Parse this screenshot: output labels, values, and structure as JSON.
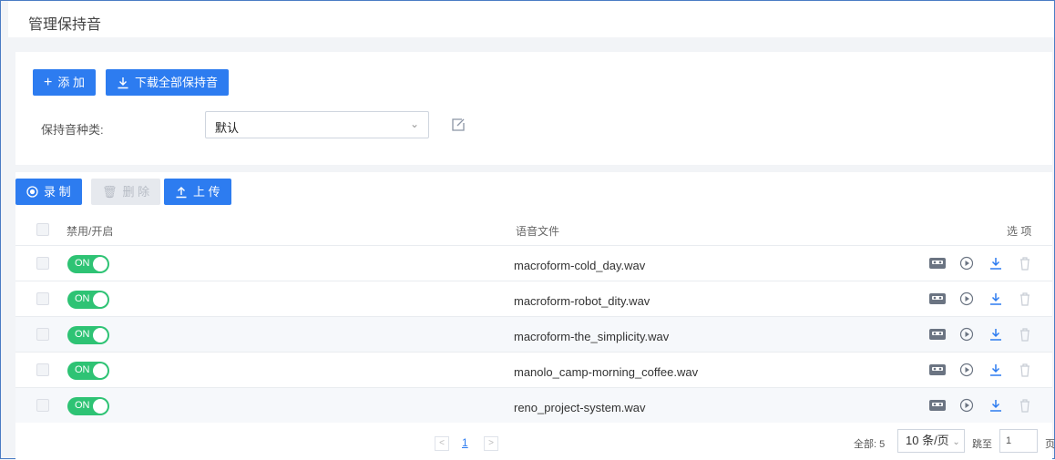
{
  "header": {
    "title": "管理保持音"
  },
  "toolbar": {
    "add_label": "添 加",
    "download_all_label": "下载全部保持音"
  },
  "filter": {
    "type_label": "保持音种类:",
    "type_value": "默认"
  },
  "actions": {
    "record_label": "录 制",
    "delete_label": "删 除",
    "upload_label": "上 传"
  },
  "table": {
    "headers": {
      "toggle": "禁用/开启",
      "file": "语音文件",
      "options": "选 项"
    },
    "rows": [
      {
        "state": "ON",
        "file": "macroform-cold_day.wav"
      },
      {
        "state": "ON",
        "file": "macroform-robot_dity.wav"
      },
      {
        "state": "ON",
        "file": "macroform-the_simplicity.wav"
      },
      {
        "state": "ON",
        "file": "manolo_camp-morning_coffee.wav"
      },
      {
        "state": "ON",
        "file": "reno_project-system.wav"
      }
    ]
  },
  "pagination": {
    "prev": "<",
    "page": "1",
    "next": ">",
    "total": "全部: 5",
    "page_size": "10 条/页",
    "jump_label": "跳至",
    "jump_value": "1",
    "page_unit": "页"
  },
  "colors": {
    "accent": "#2d7cf0",
    "toggle_on": "#2ec374"
  }
}
